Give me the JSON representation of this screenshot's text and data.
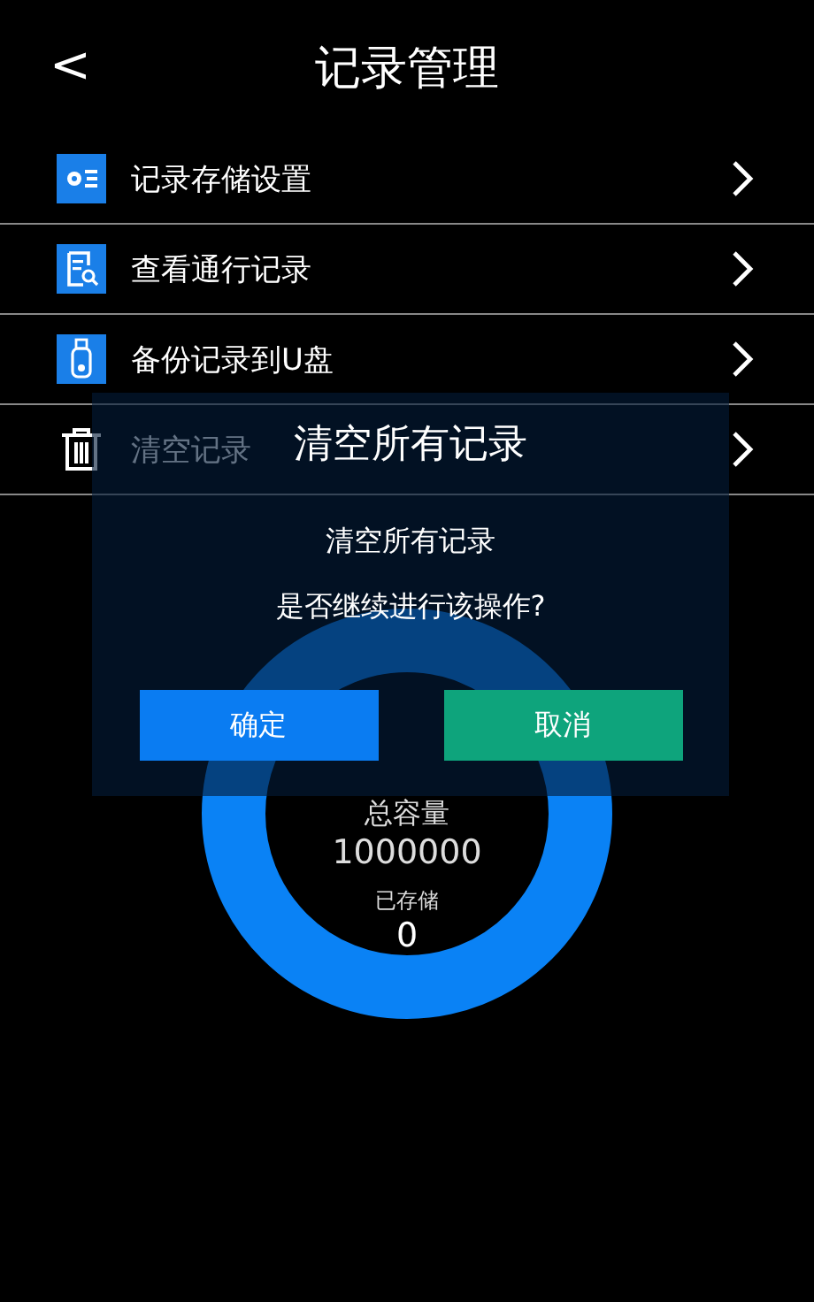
{
  "header": {
    "back": "<",
    "title": "记录管理"
  },
  "menu": [
    {
      "label": "记录存储设置",
      "kind": "settings"
    },
    {
      "label": "查看通行记录",
      "kind": "document"
    },
    {
      "label": "备份记录到U盘",
      "kind": "usb"
    },
    {
      "label": "清空记录",
      "kind": "trash"
    }
  ],
  "storage": {
    "total_label": "总容量",
    "total": "1000000",
    "stored_label": "已存储",
    "stored": "0"
  },
  "dialog": {
    "title": "清空所有记录",
    "message": "清空所有记录",
    "question": "是否继续进行该操作?",
    "confirm": "确定",
    "cancel": "取消"
  }
}
